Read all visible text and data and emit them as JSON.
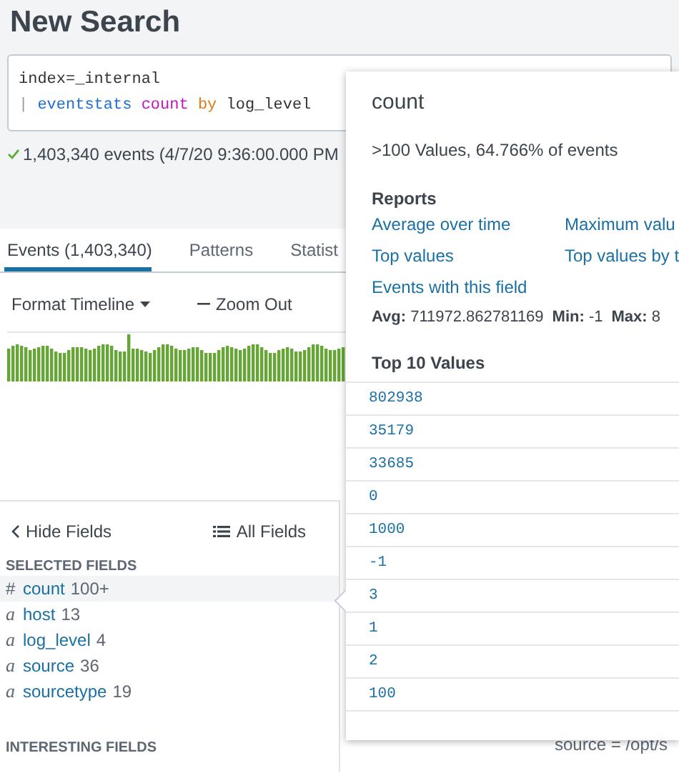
{
  "page_title": "New Search",
  "search": {
    "lines": [
      [
        {
          "kind": "plain",
          "text": "index=_internal"
        }
      ],
      [
        {
          "kind": "pipe",
          "text": "| "
        },
        {
          "kind": "command",
          "text": "eventstats "
        },
        {
          "kind": "function",
          "text": "count "
        },
        {
          "kind": "keyword",
          "text": "by"
        },
        {
          "kind": "plain",
          "text": " log_level"
        }
      ]
    ]
  },
  "result_summary": "1,403,340 events (4/7/20 9:36:00.000 PM",
  "tabs": [
    {
      "label": "Events (1,403,340)",
      "selected": true
    },
    {
      "label": "Patterns",
      "selected": false
    },
    {
      "label": "Statist",
      "selected": false
    }
  ],
  "timeline_toolbar": {
    "format": "Format Timeline",
    "zoom_out": "Zoom Out"
  },
  "fields_panel": {
    "hide": "Hide Fields",
    "all": "All Fields",
    "selected_heading": "SELECTED FIELDS",
    "interesting_heading": "INTERESTING FIELDS",
    "selected_fields": [
      {
        "type": "#",
        "name": "count",
        "count": "100+",
        "selected": true
      },
      {
        "type": "a",
        "name": "host",
        "count": "13",
        "selected": false
      },
      {
        "type": "a",
        "name": "log_level",
        "count": "4",
        "selected": false
      },
      {
        "type": "a",
        "name": "source",
        "count": "36",
        "selected": false
      },
      {
        "type": "a",
        "name": "sourcetype",
        "count": "19",
        "selected": false
      }
    ]
  },
  "event_text": "source = /opt/s",
  "popup": {
    "title": "count",
    "summary": ">100 Values, 64.766% of events",
    "reports_heading": "Reports",
    "reports": [
      [
        "Average over time",
        "Maximum valu"
      ],
      [
        "Top values",
        "Top values by t"
      ],
      [
        "Events with this field"
      ]
    ],
    "stats": [
      {
        "label": "Avg:",
        "value": "711972.862781169"
      },
      {
        "label": "Min:",
        "value": "-1"
      },
      {
        "label": "Max:",
        "value": "8"
      }
    ],
    "top_heading": "Top 10 Values",
    "top_values": [
      "802938",
      "35179",
      "33685",
      "0",
      "1000",
      "-1",
      "3",
      "1",
      "2",
      "100"
    ]
  }
}
